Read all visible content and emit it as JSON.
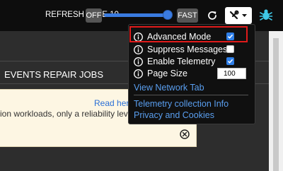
{
  "header": {
    "refresh_label": "REFRESH RATE 10",
    "off_label": "OFF",
    "fast_label": "FAST",
    "refresh_slider_level": 0.9
  },
  "nav": {
    "tabs": [
      {
        "label": "EVENTS"
      },
      {
        "label": "REPAIR JOBS"
      }
    ]
  },
  "notice": {
    "link_text": "Read here",
    "text": "ion workloads, only a reliability level of"
  },
  "settings_menu": {
    "items": [
      {
        "label": "Advanced Mode",
        "checked": true
      },
      {
        "label": "Suppress Messages",
        "checked": false
      },
      {
        "label": "Enable Telemetry",
        "checked": true
      }
    ],
    "page_size": {
      "label": "Page Size",
      "value": "100"
    },
    "view_network_tab": "View Network Tab",
    "telemetry_info": "Telemetry collection Info",
    "privacy": "Privacy and Cookies"
  },
  "colors": {
    "accent_blue": "#3a7be0",
    "highlight_red": "#e01b1b",
    "link_blue": "#5a9ff0",
    "bug_cyan": "#3fc7e6"
  }
}
